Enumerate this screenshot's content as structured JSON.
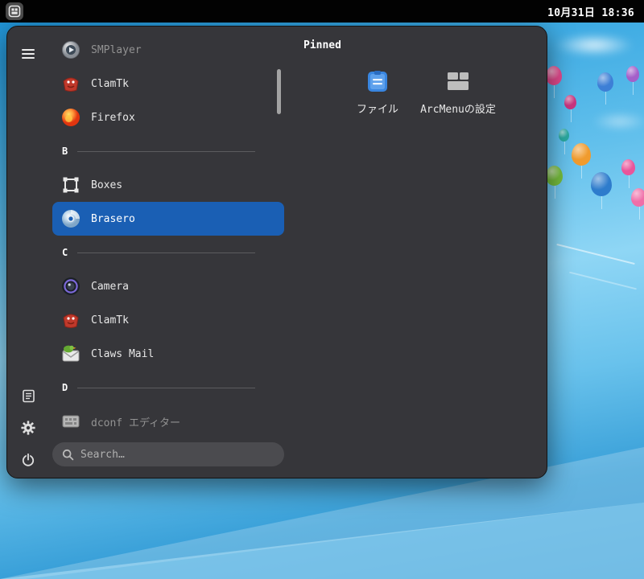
{
  "topbar": {
    "clock": "10月31日 18:36"
  },
  "menu": {
    "pinned_title": "Pinned",
    "pinned": [
      {
        "label": "ファイル",
        "icon": "files-icon"
      },
      {
        "label": "ArcMenuの設定",
        "icon": "arcmenu-settings-icon"
      }
    ],
    "apps": [
      {
        "label": "SMPlayer",
        "icon": "smplayer-icon",
        "state": "disabled"
      },
      {
        "label": "ClamTk",
        "icon": "clamtk-icon"
      },
      {
        "label": "Firefox",
        "icon": "firefox-icon"
      },
      {
        "label": "B",
        "type": "section"
      },
      {
        "label": "Boxes",
        "icon": "boxes-icon"
      },
      {
        "label": "Brasero",
        "icon": "brasero-icon",
        "state": "selected"
      },
      {
        "label": "C",
        "type": "section"
      },
      {
        "label": "Camera",
        "icon": "camera-icon"
      },
      {
        "label": "ClamTk",
        "icon": "clamtk-icon"
      },
      {
        "label": "Claws Mail",
        "icon": "claws-mail-icon"
      },
      {
        "label": "D",
        "type": "section"
      },
      {
        "label": "dconf エディター",
        "icon": "dconf-icon",
        "state": "disabled"
      }
    ],
    "search_placeholder": "Search…"
  },
  "colors": {
    "accent": "#1a5fb4",
    "panel": "#36363a",
    "topbar": "#000000",
    "selection_text": "#ffffff"
  }
}
